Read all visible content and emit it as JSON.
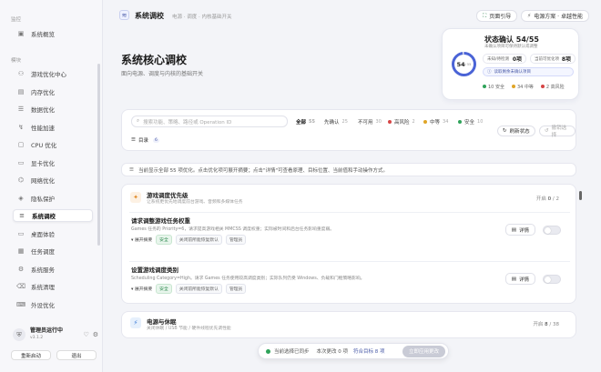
{
  "sidebar": {
    "section_overview": "监控",
    "overview_item": "系统概览",
    "section_modules": "模块",
    "items": [
      {
        "label": "游戏优化中心",
        "icon": "gamepad-icon"
      },
      {
        "label": "内存优化",
        "icon": "memory-icon"
      },
      {
        "label": "数据优化",
        "icon": "database-icon"
      },
      {
        "label": "性能加速",
        "icon": "speed-icon"
      },
      {
        "label": "CPU 优化",
        "icon": "cpu-icon"
      },
      {
        "label": "显卡优化",
        "icon": "gpu-icon"
      },
      {
        "label": "网络优化",
        "icon": "network-icon"
      },
      {
        "label": "隐私保护",
        "icon": "shield-icon"
      },
      {
        "label": "系统调校",
        "icon": "tune-icon"
      },
      {
        "label": "桌面体验",
        "icon": "desktop-icon"
      },
      {
        "label": "任务调度",
        "icon": "calendar-icon"
      },
      {
        "label": "系统服务",
        "icon": "services-icon"
      },
      {
        "label": "系统清理",
        "icon": "broom-icon"
      },
      {
        "label": "外设优化",
        "icon": "peripheral-icon"
      }
    ],
    "user_name": "管理员运行中",
    "user_version": "v3.1.2",
    "restart_label": "重新启动",
    "exit_label": "退出"
  },
  "header": {
    "title": "系统调校",
    "breadcrumb": "电源 · 调度 · 内核基础开关",
    "guide_label": "页面引导",
    "power_plan_label": "电源方案 · 卓越性能"
  },
  "hero": {
    "title": "系统核心调校",
    "subtitle": "面向电源、调度与内核的基础开关"
  },
  "status_card": {
    "title": "状态确认 54/55",
    "subtitle": "未确认项目可保持默认或调整",
    "ring_value": "54",
    "ring_total": "/ 55",
    "confirmed_pct": 98.2,
    "pending_label": "未知/待检测",
    "pending_value": "0项",
    "recommend_label": "当前可优化项",
    "recommend_value": "8项",
    "alert": "读取剩余未确认项目",
    "legend": [
      {
        "label": "10 安全",
        "color": "#2fa35a"
      },
      {
        "label": "34 中等",
        "color": "#e0a526"
      },
      {
        "label": "2 高风险",
        "color": "#d64545"
      }
    ]
  },
  "filter": {
    "search_placeholder": "搜索功能、策略、路径或 Operation ID",
    "chips": [
      {
        "label": "全部",
        "count": "55"
      },
      {
        "label": "先确认",
        "count": "25"
      },
      {
        "label": "不可用",
        "count": "30"
      },
      {
        "label": "高风险",
        "count": "2",
        "color": "#d64545"
      },
      {
        "label": "中等",
        "count": "34",
        "color": "#e0a526"
      },
      {
        "label": "安全",
        "count": "10",
        "color": "#2fa35a"
      }
    ],
    "directory_label": "目录",
    "directory_count": "6",
    "refresh_label": "刷新状态",
    "undo_label": "撤销选择"
  },
  "info_bar": "当前显示全部 55 项优化。点击优化项可展开摘要；点击\"详情\"可查看原理、目标位置、当前值和手动操作方式。",
  "groups": [
    {
      "title": "游戏调度优先级",
      "subtitle": "让系统更优先地调度前台游戏、音频和多媒体任务",
      "count": "开启",
      "count_num": "0",
      "count_total": "/ 2",
      "icon_color": "#e08a26",
      "tweaks": [
        {
          "title": "请求调整游戏任务权重",
          "desc": "Games 任务的 Priority=6，请求提高游戏相关 MMCSS 调度权重；实际被时间和后台任务影响重度弱。",
          "expand": "展开摘要",
          "tags": [
            "安全",
            "关闭前所能恢复默认",
            "管理员"
          ],
          "detail": "详情"
        },
        {
          "title": "设置游戏调度类别",
          "desc": "Scheduling Category=High。请求 Games 任务使用较高调度类别；实际队列仍受 Windows、负载和门框策略影响。",
          "expand": "展开摘要",
          "tags": [
            "安全",
            "关闭前所能恢复默认",
            "管理员"
          ],
          "detail": "详情"
        }
      ]
    },
    {
      "title": "电源与休眠",
      "subtitle": "关闭休眠 / USB 节能 / 硬件线程优先调性能",
      "count": "开启",
      "count_num": "8",
      "count_total": "/ 38",
      "icon_color": "#3a7ad6"
    }
  ],
  "bottom_bar": {
    "status": "当前选择已同步",
    "changes": "本次更改 0 项",
    "target": "符合目标 8 项",
    "apply_label": "立即应用更改"
  }
}
